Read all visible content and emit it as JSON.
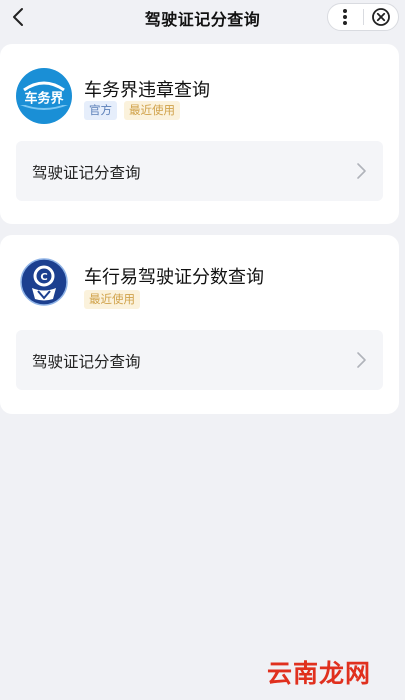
{
  "header": {
    "title": "驾驶证记分查询",
    "back_icon": "chevron-left-icon",
    "more_icon": "more-vertical-icon",
    "close_icon": "close-circle-icon"
  },
  "services": [
    {
      "name": "车务界违章查询",
      "logo_text": "车务界",
      "tags": [
        "官方",
        "最近使用"
      ],
      "entry_label": "驾驶证记分查询"
    },
    {
      "name": "车行易驾驶证分数查询",
      "tags": [
        "最近使用"
      ],
      "entry_label": "驾驶证记分查询"
    }
  ],
  "watermark": "云南龙网",
  "colors": {
    "background": "#f0f1f5",
    "card": "#ffffff",
    "tag_official_bg": "#e6eefb",
    "tag_official_text": "#5b7fb8",
    "tag_recent_bg": "#fbf2dc",
    "tag_recent_text": "#d0a24a",
    "logo1_blue": "#1a8fd6",
    "logo2_navy": "#1c3f8f",
    "watermark_red": "#e0301e"
  }
}
